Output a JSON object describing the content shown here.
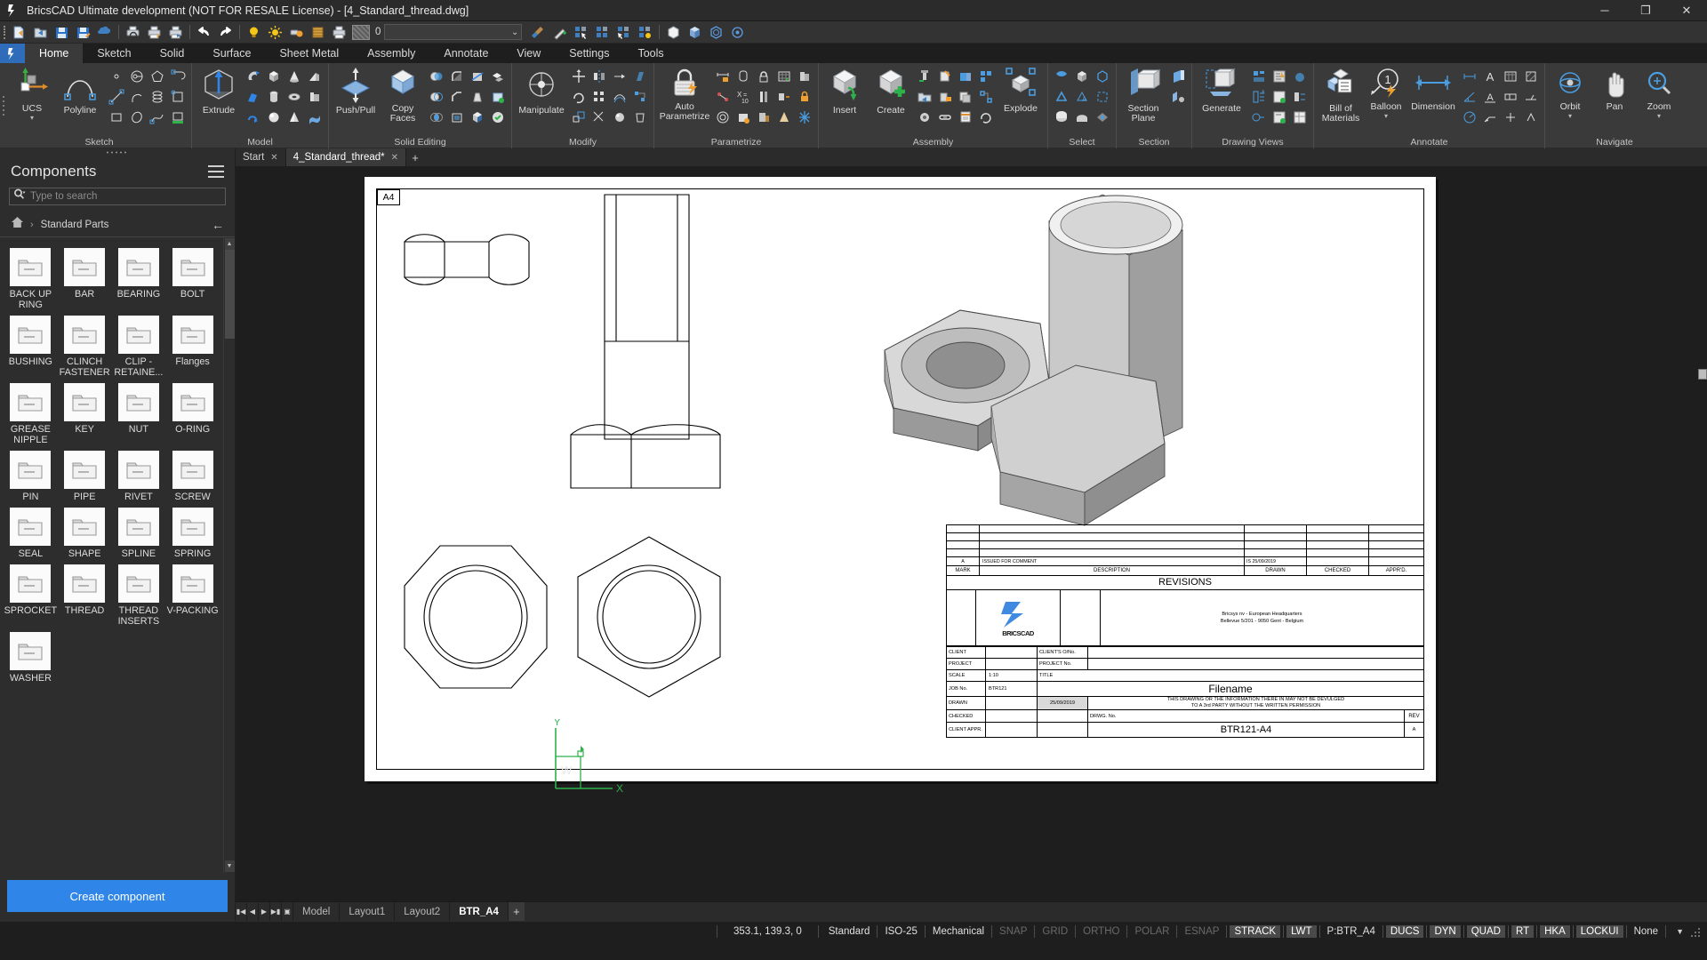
{
  "window": {
    "title": "BricsCAD Ultimate development (NOT FOR RESALE License) - [4_Standard_thread.dwg]",
    "minimize": "─",
    "maximize": "❐",
    "close": "✕"
  },
  "quick_access": {
    "buttons": [
      {
        "name": "new-drawing",
        "icon": "new-file-icon"
      },
      {
        "name": "open-drawing",
        "icon": "open-folder-icon"
      },
      {
        "name": "save-drawing",
        "icon": "save-floppy-icon"
      },
      {
        "name": "save-as-drawing",
        "icon": "save-as-icon"
      },
      {
        "name": "export-drawing",
        "icon": "export-cloud-icon"
      },
      {
        "name": "print-preview",
        "icon": "print-preview-icon"
      },
      {
        "name": "page-setup",
        "icon": "page-setup-icon"
      },
      {
        "name": "print",
        "icon": "printer-icon"
      },
      {
        "name": "undo",
        "icon": "undo-arrow-icon"
      },
      {
        "name": "redo",
        "icon": "redo-arrow-icon"
      },
      {
        "name": "layer-on-off",
        "icon": "lightbulb-icon"
      },
      {
        "name": "layer-freeze",
        "icon": "sun-icon"
      },
      {
        "name": "layer-lock",
        "icon": "lock-layer-icon"
      },
      {
        "name": "layer-states",
        "icon": "layer-states-icon"
      },
      {
        "name": "layer-plot",
        "icon": "plot-layer-icon"
      }
    ],
    "layer_value": "0",
    "dropdown_caret": "⌄",
    "right_buttons": [
      {
        "name": "clean-screen",
        "icon": "broom-icon"
      },
      {
        "name": "quick-select",
        "icon": "magic-wand-icon"
      },
      {
        "name": "select-similar",
        "icon": "select-similar-icon"
      },
      {
        "name": "select-all",
        "icon": "select-all-icon"
      },
      {
        "name": "select-filter",
        "icon": "select-filter-icon"
      },
      {
        "name": "select-highlight",
        "icon": "select-highlight-icon"
      },
      {
        "name": "visual-style-wireframe",
        "icon": "cube-wireframe-icon"
      },
      {
        "name": "visual-style-shaded",
        "icon": "cube-shaded-icon"
      },
      {
        "name": "visual-style-realistic",
        "icon": "cube-realistic-icon"
      },
      {
        "name": "render",
        "icon": "render-icon"
      }
    ]
  },
  "ribbon": {
    "tabs": [
      {
        "label": "Home",
        "active": true
      },
      {
        "label": "Sketch",
        "active": false
      },
      {
        "label": "Solid",
        "active": false
      },
      {
        "label": "Surface",
        "active": false
      },
      {
        "label": "Sheet Metal",
        "active": false
      },
      {
        "label": "Assembly",
        "active": false
      },
      {
        "label": "Annotate",
        "active": false
      },
      {
        "label": "View",
        "active": false
      },
      {
        "label": "Settings",
        "active": false
      },
      {
        "label": "Tools",
        "active": false
      }
    ],
    "groups": [
      {
        "title": "Sketch",
        "big": [
          {
            "label": "UCS",
            "icon": "ucs-axes-icon",
            "caret": true
          },
          {
            "label": "Polyline",
            "icon": "polyline-icon",
            "caret": false
          }
        ],
        "small_count": 18
      },
      {
        "title": "Model",
        "big": [
          {
            "label": "Extrude",
            "icon": "extrude-cube-icon",
            "caret": false
          }
        ],
        "small_count": 12
      },
      {
        "title": "Solid Editing",
        "big": [
          {
            "label": "Push/Pull",
            "icon": "push-pull-icon",
            "caret": false
          },
          {
            "label": "Copy Faces",
            "icon": "copy-faces-icon",
            "caret": false
          }
        ],
        "small_count": 15
      },
      {
        "title": "Modify",
        "big": [
          {
            "label": "Manipulate",
            "icon": "manipulate-icon",
            "caret": false
          }
        ],
        "small_count": 12
      },
      {
        "title": "Parametrize",
        "big": [
          {
            "label": "Auto Parametrize",
            "icon": "auto-parametrize-lock-icon",
            "caret": false
          }
        ],
        "small_count": 15
      },
      {
        "title": "Assembly",
        "big": [
          {
            "label": "Insert",
            "icon": "insert-component-icon",
            "caret": false
          },
          {
            "label": "Create",
            "icon": "create-component-icon",
            "caret": false
          },
          {
            "label": "Explode",
            "icon": "explode-icon",
            "caret": false
          }
        ],
        "small_count": 12
      },
      {
        "title": "Select",
        "big": [],
        "small_count": 9
      },
      {
        "title": "Section",
        "big": [
          {
            "label": "Section Plane",
            "icon": "section-plane-icon",
            "caret": false
          }
        ],
        "small_count": 3
      },
      {
        "title": "Drawing Views",
        "big": [
          {
            "label": "Generate",
            "icon": "generate-views-icon",
            "caret": false
          }
        ],
        "small_count": 9
      },
      {
        "title": "Annotate",
        "big": [
          {
            "label": "Bill of Materials",
            "icon": "bill-of-materials-icon",
            "caret": false
          },
          {
            "label": "Balloon",
            "icon": "balloon-icon",
            "caret": true
          },
          {
            "label": "Dimension",
            "icon": "dimension-icon",
            "caret": false
          }
        ],
        "small_count": 15
      },
      {
        "title": "Navigate",
        "big": [
          {
            "label": "Orbit",
            "icon": "orbit-icon",
            "caret": true
          },
          {
            "label": "Pan",
            "icon": "pan-hand-icon",
            "caret": false
          },
          {
            "label": "Zoom",
            "icon": "zoom-magnifier-icon",
            "caret": true
          }
        ],
        "small_count": 0
      }
    ]
  },
  "sidebar": {
    "title": "Components",
    "menu_icon": "hamburger-menu-icon",
    "search_placeholder": "Type to search",
    "search_value": "",
    "search_icon": "search-magnifier-icon",
    "breadcrumb_home_icon": "home-icon",
    "breadcrumb_chevron": "›",
    "breadcrumb": "Standard Parts",
    "back_arrow": "←",
    "components": [
      "BACK UP RING",
      "BAR",
      "BEARING",
      "BOLT",
      "BUSHING",
      "CLINCH FASTENER",
      "CLIP - RETAINE...",
      "Flanges",
      "GREASE NIPPLE",
      "KEY",
      "NUT",
      "O-RING",
      "PIN",
      "PIPE",
      "RIVET",
      "SCREW",
      "SEAL",
      "SHAPE",
      "SPLINE",
      "SPRING",
      "SPROCKET",
      "THREAD",
      "THREAD INSERTS",
      "V-PACKING",
      "WASHER"
    ],
    "create_button": "Create component",
    "accent_color": "#2f86e8"
  },
  "document_tabs": [
    {
      "label": "Start",
      "active": false,
      "close": "✕"
    },
    {
      "label": "4_Standard_thread*",
      "active": true,
      "close": "✕"
    }
  ],
  "document_tab_add": "+",
  "drawing": {
    "sheet_label": "A4",
    "title_block": {
      "revisions_label": "REVISIONS",
      "rev_rows": [
        {
          "mark": "",
          "description": "",
          "drawn": "",
          "checked": "",
          "appr": ""
        },
        {
          "mark": "",
          "description": "",
          "drawn": "",
          "checked": "",
          "appr": ""
        },
        {
          "mark": "",
          "description": "",
          "drawn": "",
          "checked": "",
          "appr": ""
        },
        {
          "mark": "",
          "description": "",
          "drawn": "",
          "checked": "",
          "appr": ""
        },
        {
          "mark": "A",
          "description": "ISSUED FOR COMMENT",
          "drawn": "IS 25/09/2019",
          "checked": "",
          "appr": ""
        }
      ],
      "rev_headers": {
        "mark": "MARK",
        "description": "DESCRIPTION",
        "drawn": "DRAWN",
        "checked": "CHECKED",
        "appr": "APPR'D."
      },
      "logo_text": "BRICSCAD",
      "company_line1": "Bricsys nv - European Headquarters",
      "company_line2": "Bellevue 5/201 - 9050 Gent - Belgium",
      "fields": {
        "client_label": "CLIENT",
        "client_value": "",
        "clients_ono_label": "CLIENT'S O/No.",
        "clients_ono_value": "",
        "project_label": "PROJECT",
        "project_value": "",
        "project_no_label": "PROJECT No.",
        "project_no_value": "",
        "scale_label": "SCALE",
        "scale_value": "1:10",
        "title_label": "TITLE",
        "title_value": "Filename",
        "job_no_label": "JOB No.",
        "job_no_value": "BTR121",
        "drawn_label": "DRAWN",
        "drawn_value": "",
        "drawn_date": "25/09/2019",
        "disclaimer_line1": "THIS DRAWING OR THE INFORMATION THERE IN MAY NOT BE DEVULGED",
        "disclaimer_line2": "TO A 3rd PARTY WITHOUT THE WRITTEN PERMISSION",
        "checked_label": "CHECKED",
        "checked_value": "",
        "drwg_no_label": "DRWG. No.",
        "drwg_no_value": "BTR121-A4",
        "rev_label": "REV",
        "rev_value": "A",
        "client_appr_label": "CLIENT APPR.",
        "client_appr_value": ""
      }
    },
    "ucs": {
      "x_label": "X",
      "y_label": "Y",
      "w_label": "W"
    }
  },
  "layout_tabs": {
    "nav": [
      "◀❘",
      "◀",
      "▶",
      "❘▶",
      "▣"
    ],
    "tabs": [
      {
        "label": "Model",
        "active": false
      },
      {
        "label": "Layout1",
        "active": false
      },
      {
        "label": "Layout2",
        "active": false
      },
      {
        "label": "BTR_A4",
        "active": true
      }
    ],
    "add": "+"
  },
  "statusbar": {
    "coordinates": "353.1, 139.3, 0",
    "items": [
      {
        "label": "Standard",
        "state": "normal"
      },
      {
        "label": "ISO-25",
        "state": "normal"
      },
      {
        "label": "Mechanical",
        "state": "normal"
      },
      {
        "label": "SNAP",
        "state": "off"
      },
      {
        "label": "GRID",
        "state": "off"
      },
      {
        "label": "ORTHO",
        "state": "off"
      },
      {
        "label": "POLAR",
        "state": "off"
      },
      {
        "label": "ESNAP",
        "state": "off"
      },
      {
        "label": "STRACK",
        "state": "on"
      },
      {
        "label": "LWT",
        "state": "on"
      },
      {
        "label": "P:BTR_A4",
        "state": "normal"
      },
      {
        "label": "DUCS",
        "state": "on"
      },
      {
        "label": "DYN",
        "state": "on"
      },
      {
        "label": "QUAD",
        "state": "on"
      },
      {
        "label": "RT",
        "state": "on"
      },
      {
        "label": "HKA",
        "state": "on"
      },
      {
        "label": "LOCKUI",
        "state": "on"
      },
      {
        "label": "None",
        "state": "normal"
      }
    ],
    "dropdown_caret": "▼",
    "resize_grip": "resize-grip-icon"
  }
}
